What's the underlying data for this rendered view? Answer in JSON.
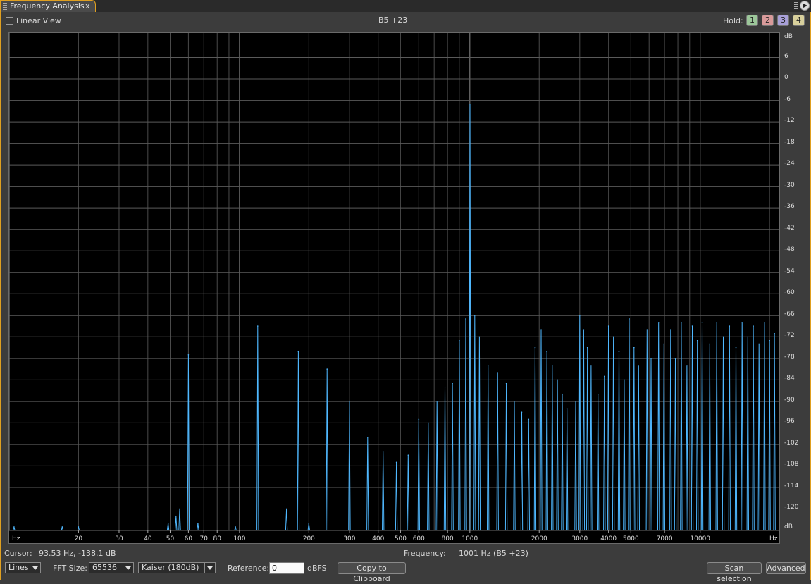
{
  "tab": {
    "title": "Frequency Analysis",
    "close": "x"
  },
  "toolbar": {
    "linear_view": "Linear View",
    "note": "B5 +23",
    "hold_label": "Hold:",
    "hold_buttons": [
      "1",
      "2",
      "3",
      "4"
    ]
  },
  "colors": {
    "accent": "#e0a020",
    "spectrum": "#4fb8ff",
    "hold1": "#9cc79a",
    "hold2": "#d89a9a",
    "hold3": "#a8a0d8",
    "hold4": "#d8d09c"
  },
  "status": {
    "cursor_label": "Cursor:",
    "cursor_value": "93.53 Hz, -138.1 dB",
    "frequency_label": "Frequency:",
    "frequency_value": "1001 Hz (B5 +23)"
  },
  "controls": {
    "display_mode": "Lines",
    "fft_label": "FFT Size:",
    "fft_size": "65536",
    "window": "Kaiser (180dB)",
    "reference_label": "Reference:",
    "reference_value": "0",
    "reference_unit": "dBFS",
    "copy_button": "Copy to Clipboard",
    "scan_button": "Scan selection",
    "advanced_button": "Advanced"
  },
  "chart_data": {
    "type": "line",
    "x_scale": "log",
    "xlim": [
      10,
      22050
    ],
    "ylim": [
      -126,
      12
    ],
    "grid": true,
    "x_unit": "Hz",
    "y_unit": "dB",
    "x_ticks": [
      "20",
      "30",
      "40",
      "50",
      "60",
      "70",
      "80",
      "100",
      "200",
      "300",
      "400",
      "500",
      "600",
      "800",
      "1000",
      "2000",
      "3000",
      "4000",
      "5000",
      "7000",
      "10000"
    ],
    "y_ticks": [
      "6",
      "0",
      "-6",
      "-12",
      "-18",
      "-24",
      "-30",
      "-36",
      "-42",
      "-48",
      "-54",
      "-60",
      "-66",
      "-72",
      "-78",
      "-84",
      "-90",
      "-96",
      "-102",
      "-108",
      "-114",
      "-120"
    ],
    "peaks": [
      {
        "f": 10.5,
        "db": -125
      },
      {
        "f": 17,
        "db": -125
      },
      {
        "f": 20,
        "db": -125
      },
      {
        "f": 49,
        "db": -124
      },
      {
        "f": 53,
        "db": -122
      },
      {
        "f": 55,
        "db": -120
      },
      {
        "f": 60,
        "db": -77
      },
      {
        "f": 66,
        "db": -124
      },
      {
        "f": 96,
        "db": -125
      },
      {
        "f": 120,
        "db": -69
      },
      {
        "f": 160,
        "db": -120
      },
      {
        "f": 180,
        "db": -76
      },
      {
        "f": 200,
        "db": -124
      },
      {
        "f": 240,
        "db": -81
      },
      {
        "f": 300,
        "db": -90
      },
      {
        "f": 360,
        "db": -100
      },
      {
        "f": 420,
        "db": -104
      },
      {
        "f": 480,
        "db": -107
      },
      {
        "f": 540,
        "db": -105
      },
      {
        "f": 600,
        "db": -95
      },
      {
        "f": 660,
        "db": -96
      },
      {
        "f": 720,
        "db": -90
      },
      {
        "f": 780,
        "db": -86
      },
      {
        "f": 840,
        "db": -85
      },
      {
        "f": 900,
        "db": -73
      },
      {
        "f": 960,
        "db": -67
      },
      {
        "f": 1001,
        "db": -7
      },
      {
        "f": 1050,
        "db": -66
      },
      {
        "f": 1100,
        "db": -72
      },
      {
        "f": 1200,
        "db": -80
      },
      {
        "f": 1320,
        "db": -82
      },
      {
        "f": 1440,
        "db": -85
      },
      {
        "f": 1560,
        "db": -90
      },
      {
        "f": 1680,
        "db": -93
      },
      {
        "f": 1800,
        "db": -95
      },
      {
        "f": 1920,
        "db": -75
      },
      {
        "f": 2040,
        "db": -70
      },
      {
        "f": 2160,
        "db": -76
      },
      {
        "f": 2280,
        "db": -80
      },
      {
        "f": 2400,
        "db": -84
      },
      {
        "f": 2520,
        "db": -88
      },
      {
        "f": 2640,
        "db": -92
      },
      {
        "f": 2880,
        "db": -90
      },
      {
        "f": 3000,
        "db": -66
      },
      {
        "f": 3120,
        "db": -70
      },
      {
        "f": 3240,
        "db": -75
      },
      {
        "f": 3360,
        "db": -80
      },
      {
        "f": 3600,
        "db": -88
      },
      {
        "f": 3840,
        "db": -83
      },
      {
        "f": 4000,
        "db": -69
      },
      {
        "f": 4200,
        "db": -72
      },
      {
        "f": 4440,
        "db": -76
      },
      {
        "f": 4680,
        "db": -84
      },
      {
        "f": 4920,
        "db": -67
      },
      {
        "f": 5160,
        "db": -75
      },
      {
        "f": 5400,
        "db": -80
      },
      {
        "f": 5880,
        "db": -70
      },
      {
        "f": 6120,
        "db": -78
      },
      {
        "f": 6600,
        "db": -68
      },
      {
        "f": 6960,
        "db": -74
      },
      {
        "f": 7440,
        "db": -70
      },
      {
        "f": 7800,
        "db": -78
      },
      {
        "f": 8280,
        "db": -68
      },
      {
        "f": 8760,
        "db": -80
      },
      {
        "f": 9240,
        "db": -69
      },
      {
        "f": 9720,
        "db": -73
      },
      {
        "f": 10200,
        "db": -68
      },
      {
        "f": 11000,
        "db": -74
      },
      {
        "f": 11800,
        "db": -68
      },
      {
        "f": 12600,
        "db": -72
      },
      {
        "f": 13400,
        "db": -69
      },
      {
        "f": 14300,
        "db": -75
      },
      {
        "f": 15200,
        "db": -68
      },
      {
        "f": 16100,
        "db": -72
      },
      {
        "f": 17000,
        "db": -69
      },
      {
        "f": 18000,
        "db": -74
      },
      {
        "f": 19000,
        "db": -68
      },
      {
        "f": 20000,
        "db": -73
      },
      {
        "f": 21000,
        "db": -71
      }
    ]
  }
}
